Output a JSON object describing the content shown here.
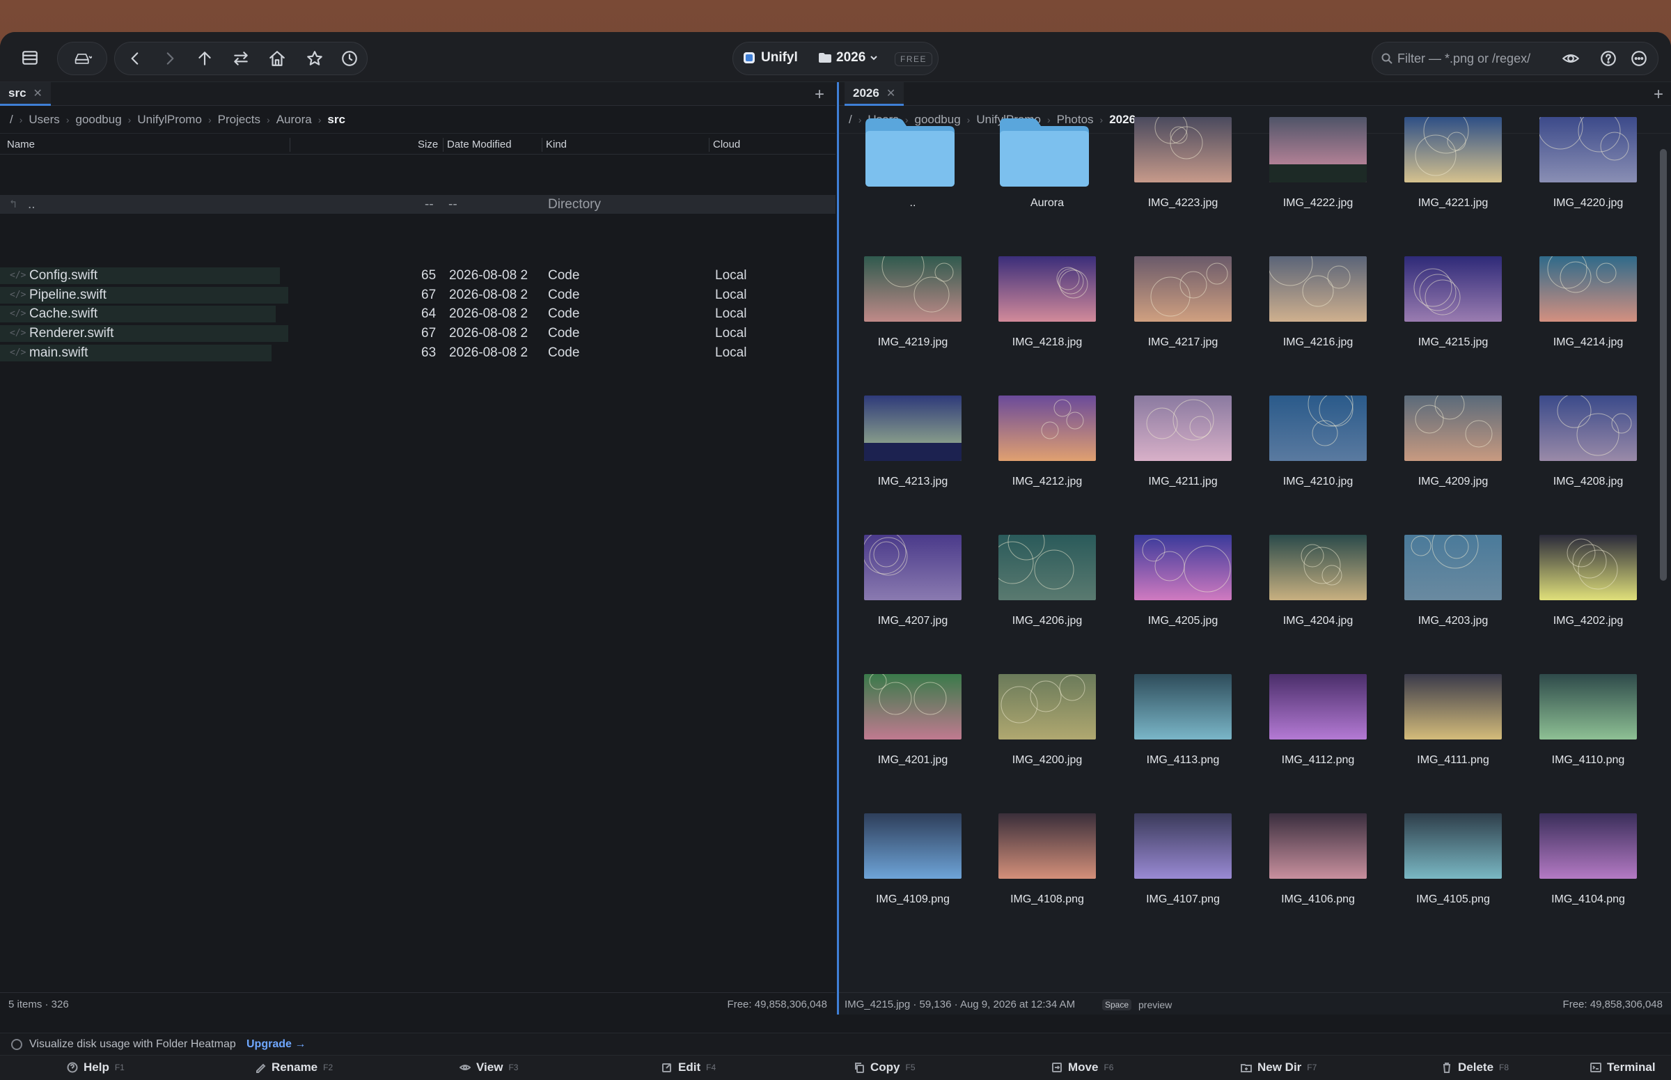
{
  "app": {
    "name": "Unifyl",
    "folder": "2026",
    "badge": "FREE"
  },
  "search": {
    "placeholder": "Filter — *.png or /regex/"
  },
  "left": {
    "tab": "src",
    "crumbs": [
      "/",
      "Users",
      "goodbug",
      "UnifylPromo",
      "Projects",
      "Aurora",
      "src"
    ],
    "columns": {
      "name": "Name",
      "size": "Size",
      "date": "Date Modified",
      "kind": "Kind",
      "cloud": "Cloud"
    },
    "up_row": {
      "name": "..",
      "size": "--",
      "date": "--",
      "kind": "Directory"
    },
    "rows": [
      {
        "name": "Config.swift",
        "size": "65",
        "date": "2026-08-08 2",
        "kind": "Code",
        "cloud": "Local",
        "usage": 0.335
      },
      {
        "name": "Pipeline.swift",
        "size": "67",
        "date": "2026-08-08 2",
        "kind": "Code",
        "cloud": "Local",
        "usage": 0.345
      },
      {
        "name": "Cache.swift",
        "size": "64",
        "date": "2026-08-08 2",
        "kind": "Code",
        "cloud": "Local",
        "usage": 0.33
      },
      {
        "name": "Renderer.swift",
        "size": "67",
        "date": "2026-08-08 2",
        "kind": "Code",
        "cloud": "Local",
        "usage": 0.345
      },
      {
        "name": "main.swift",
        "size": "63",
        "date": "2026-08-08 2",
        "kind": "Code",
        "cloud": "Local",
        "usage": 0.325
      }
    ],
    "status": {
      "items": "5 items · 326",
      "free": "Free: 49,858,306,048"
    }
  },
  "right": {
    "tab": "2026",
    "crumbs": [
      "/",
      "Users",
      "goodbug",
      "UnifylPromo",
      "Photos",
      "2026"
    ],
    "folders": [
      "..",
      "Aurora"
    ],
    "images": [
      {
        "name": "IMG_4223.jpg",
        "sky": [
          "#4a4a5e",
          "#c79a8a"
        ],
        "ground": "#2a1f26",
        "rings": true
      },
      {
        "name": "IMG_4222.jpg",
        "sky": [
          "#4f5468",
          "#d691a6"
        ],
        "ground": "#1d2a26",
        "rings": false
      },
      {
        "name": "IMG_4221.jpg",
        "sky": [
          "#2e4f86",
          "#d6c28e"
        ],
        "ground": "#1d2b4a",
        "rings": true
      },
      {
        "name": "IMG_4220.jpg",
        "sky": [
          "#3c4a8a",
          "#8a8fb4"
        ],
        "ground": "#1e2a55",
        "rings": true
      },
      {
        "name": "IMG_4219.jpg",
        "sky": [
          "#2f5a4e",
          "#c08a88"
        ],
        "ground": "#1c3a2c",
        "rings": true
      },
      {
        "name": "IMG_4218.jpg",
        "sky": [
          "#3b2e7a",
          "#d28a9a"
        ],
        "ground": "#1a1f5a",
        "rings": true
      },
      {
        "name": "IMG_4217.jpg",
        "sky": [
          "#6a5a6a",
          "#d0a080"
        ],
        "ground": "#2a2d36",
        "rings": true
      },
      {
        "name": "IMG_4216.jpg",
        "sky": [
          "#5a6478",
          "#cfb08e"
        ],
        "ground": "#283340",
        "rings": true
      },
      {
        "name": "IMG_4215.jpg",
        "sky": [
          "#2e2a78",
          "#9a7cb0"
        ],
        "ground": "#1a1a4a",
        "rings": true
      },
      {
        "name": "IMG_4214.jpg",
        "sky": [
          "#2f6a8a",
          "#d49080"
        ],
        "ground": "#2a3a48",
        "rings": true
      },
      {
        "name": "IMG_4213.jpg",
        "sky": [
          "#2e3a7a",
          "#a8c090"
        ],
        "ground": "#1c2250",
        "rings": false
      },
      {
        "name": "IMG_4212.jpg",
        "sky": [
          "#6a4a9a",
          "#e0a070"
        ],
        "ground": "#2d2448",
        "rings": true
      },
      {
        "name": "IMG_4211.jpg",
        "sky": [
          "#8a7aa0",
          "#d8b0c8"
        ],
        "ground": "#2a2d36",
        "rings": true
      },
      {
        "name": "IMG_4210.jpg",
        "sky": [
          "#2a5a8a",
          "#5a7aa0"
        ],
        "ground": "#1a2a40",
        "rings": true
      },
      {
        "name": "IMG_4209.jpg",
        "sky": [
          "#5a6a7a",
          "#c89a80"
        ],
        "ground": "#2a302c",
        "rings": true
      },
      {
        "name": "IMG_4208.jpg",
        "sky": [
          "#3a4a8a",
          "#9a8aa8"
        ],
        "ground": "#232a48",
        "rings": true
      },
      {
        "name": "IMG_4207.jpg",
        "sky": [
          "#4a3a8a",
          "#8a7ab0"
        ],
        "ground": "#1e1c40",
        "rings": true
      },
      {
        "name": "IMG_4206.jpg",
        "sky": [
          "#2a5a5a",
          "#5a7a70"
        ],
        "ground": "#1c2e30",
        "rings": true
      },
      {
        "name": "IMG_4205.jpg",
        "sky": [
          "#3a3a9a",
          "#d07ac0"
        ],
        "ground": "#1f2a55",
        "rings": true
      },
      {
        "name": "IMG_4204.jpg",
        "sky": [
          "#2a4a4a",
          "#c8b080"
        ],
        "ground": "#222a2a",
        "rings": true
      },
      {
        "name": "IMG_4203.jpg",
        "sky": [
          "#4a7a9a",
          "#6a8aa0"
        ],
        "ground": "#203848",
        "rings": true
      },
      {
        "name": "IMG_4202.jpg",
        "sky": [
          "#2a2a3a",
          "#e0e07a"
        ],
        "ground": "#1a1c28",
        "rings": true
      },
      {
        "name": "IMG_4201.jpg",
        "sky": [
          "#3a7a4a",
          "#c07a90"
        ],
        "ground": "#1e3a2a",
        "rings": true
      },
      {
        "name": "IMG_4200.jpg",
        "sky": [
          "#6a7a5a",
          "#b0a870"
        ],
        "ground": "#252a24",
        "rings": true
      },
      {
        "name": "IMG_4113.png",
        "sky": [
          "#2e4c5a",
          "#7ab6c8"
        ],
        "ground": "",
        "rings": false
      },
      {
        "name": "IMG_4112.png",
        "sky": [
          "#4a2e6a",
          "#b47ad4"
        ],
        "ground": "",
        "rings": false
      },
      {
        "name": "IMG_4111.png",
        "sky": [
          "#3a3a4a",
          "#d4bc7a"
        ],
        "ground": "",
        "rings": false
      },
      {
        "name": "IMG_4110.png",
        "sky": [
          "#2e4a4a",
          "#8ec094"
        ],
        "ground": "",
        "rings": false
      },
      {
        "name": "IMG_4109.png",
        "sky": [
          "#2e3e5a",
          "#6ea4d8"
        ],
        "ground": "",
        "rings": false
      },
      {
        "name": "IMG_4108.png",
        "sky": [
          "#3a2e3a",
          "#d4907a"
        ],
        "ground": "",
        "rings": false
      },
      {
        "name": "IMG_4107.png",
        "sky": [
          "#3a3a5a",
          "#9a8ad4"
        ],
        "ground": "",
        "rings": false
      },
      {
        "name": "IMG_4106.png",
        "sky": [
          "#3a2e3e",
          "#c8909e"
        ],
        "ground": "",
        "rings": false
      },
      {
        "name": "IMG_4105.png",
        "sky": [
          "#2e3e4a",
          "#7ab8c4"
        ],
        "ground": "",
        "rings": false
      },
      {
        "name": "IMG_4104.png",
        "sky": [
          "#3a2e5a",
          "#b47ac4"
        ],
        "ground": "",
        "rings": false
      }
    ],
    "status": {
      "selection": "IMG_4215.jpg · 59,136 · Aug 9, 2026 at 12:34 AM",
      "key": "Space",
      "key_label": "preview",
      "free": "Free: 49,858,306,048"
    }
  },
  "upgrade": {
    "text": "Visualize disk usage with Folder Heatmap",
    "link": "Upgrade →"
  },
  "fnkeys": [
    {
      "label": "Help",
      "key": "F1",
      "icon": "help-icon"
    },
    {
      "label": "Rename",
      "key": "F2",
      "icon": "pencil-icon"
    },
    {
      "label": "View",
      "key": "F3",
      "icon": "eye-icon"
    },
    {
      "label": "Edit",
      "key": "F4",
      "icon": "edit-icon"
    },
    {
      "label": "Copy",
      "key": "F5",
      "icon": "copy-icon"
    },
    {
      "label": "Move",
      "key": "F6",
      "icon": "move-icon"
    },
    {
      "label": "New Dir",
      "key": "F7",
      "icon": "new-folder-icon"
    },
    {
      "label": "Delete",
      "key": "F8",
      "icon": "trash-icon"
    },
    {
      "label": "Terminal",
      "key": "",
      "icon": "terminal-icon"
    }
  ]
}
